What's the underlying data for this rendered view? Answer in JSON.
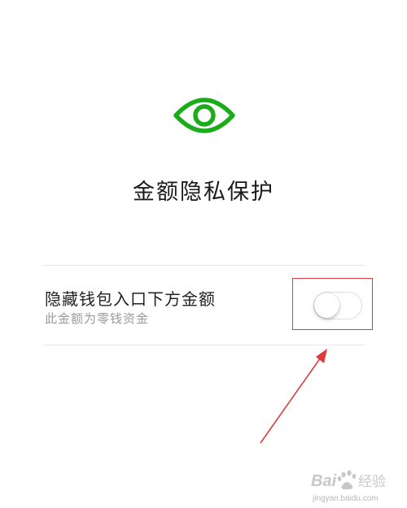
{
  "header": {
    "icon": "eye-icon",
    "title": "金额隐私保护"
  },
  "setting": {
    "label": "隐藏钱包入口下方金额",
    "description": "此金额为零钱资金",
    "toggle_state": "off"
  },
  "colors": {
    "accent": "#1aad19",
    "annotation": "#e0393e"
  },
  "watermark": {
    "brand": "Baidu经验",
    "url": "jingyan.baidu.com"
  }
}
